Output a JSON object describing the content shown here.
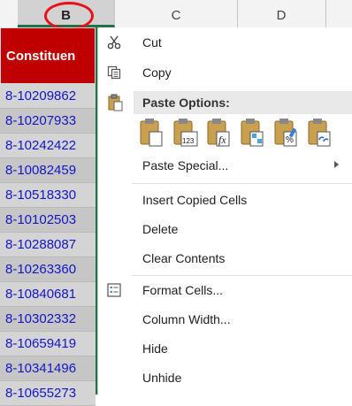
{
  "column_header": {
    "columns": [
      {
        "id": "partial_left",
        "label": ""
      },
      {
        "id": "B",
        "label": "B"
      },
      {
        "id": "C",
        "label": "C"
      },
      {
        "id": "D",
        "label": "D"
      },
      {
        "id": "E",
        "label": ""
      }
    ],
    "selected": "B"
  },
  "sheet": {
    "header_cell": "Constituen",
    "rows": [
      "8-10209862",
      "8-10207933",
      "8-10242422",
      "8-10082459",
      "8-10518330",
      "8-10102503",
      "8-10288087",
      "8-10263360",
      "8-10840681",
      "8-10302332",
      "8-10659419",
      "8-10341496",
      "8-10655273"
    ]
  },
  "context_menu": {
    "items": {
      "cut": {
        "label": "Cut",
        "icon": "scissors-icon"
      },
      "copy": {
        "label": "Copy",
        "icon": "copy-icon"
      },
      "paste_options_header": {
        "label": "Paste Options:",
        "icon": "clipboard-icon"
      },
      "paste_special": {
        "label": "Paste Special..."
      },
      "insert_copied_cells": {
        "label": "Insert Copied Cells"
      },
      "delete": {
        "label": "Delete"
      },
      "clear_contents": {
        "label": "Clear Contents"
      },
      "format_cells": {
        "label": "Format Cells...",
        "icon": "format-cells-icon"
      },
      "column_width": {
        "label": "Column Width..."
      },
      "hide": {
        "label": "Hide"
      },
      "unhide": {
        "label": "Unhide"
      }
    },
    "paste_icons": [
      "paste-icon",
      "paste-values-icon",
      "paste-formulas-icon",
      "paste-transpose-icon",
      "paste-formatting-icon",
      "paste-link-icon"
    ]
  },
  "colors": {
    "header_red": "#c00000",
    "link_blue": "#1515c8",
    "accent_green": "#217346",
    "highlight_circle": "#e8101a"
  }
}
